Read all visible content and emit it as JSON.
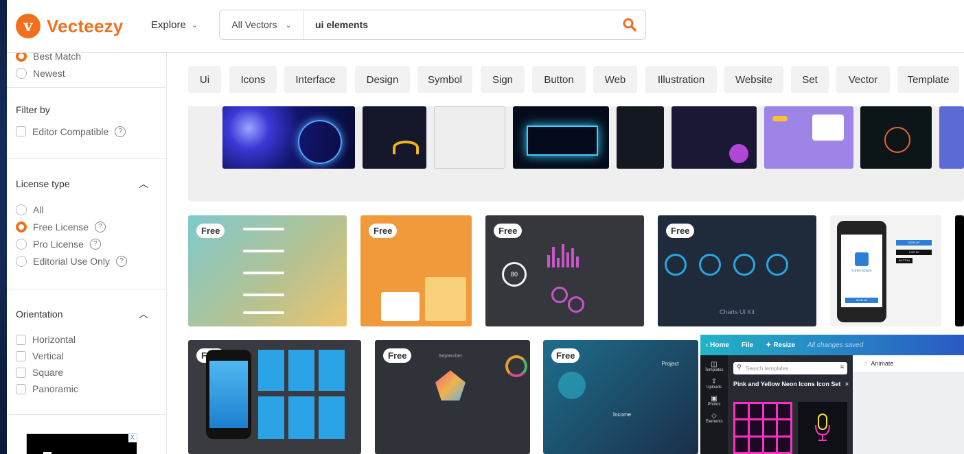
{
  "header": {
    "logo_text": "Vecteezy",
    "logo_mark": "v",
    "explore_label": "Explore",
    "search_type": "All Vectors",
    "search_value": "ui elements",
    "brand_color": "#f0701e"
  },
  "sidebar": {
    "sort_options": [
      {
        "label": "Best Match",
        "selected": true
      },
      {
        "label": "Newest",
        "selected": false
      }
    ],
    "filter_by": {
      "title": "Filter by",
      "options": [
        {
          "label": "Editor Compatible",
          "help": "?"
        }
      ]
    },
    "license": {
      "title": "License type",
      "options": [
        {
          "label": "All",
          "selected": false
        },
        {
          "label": "Free License",
          "selected": true,
          "help": "?"
        },
        {
          "label": "Pro License",
          "selected": false,
          "help": "?"
        },
        {
          "label": "Editorial Use Only",
          "selected": false,
          "help": "?"
        }
      ]
    },
    "orientation": {
      "title": "Orientation",
      "options": [
        "Horizontal",
        "Vertical",
        "Square",
        "Panoramic"
      ]
    },
    "ad_close": "X"
  },
  "chips": [
    "Ui",
    "Icons",
    "Interface",
    "Design",
    "Symbol",
    "Sign",
    "Button",
    "Web",
    "Illustration",
    "Website",
    "Set",
    "Vector",
    "Template"
  ],
  "results": {
    "badge": "Free",
    "card_texts": {
      "charts_title": "Charts UI Kit",
      "lorem": "Lorem Ipsum",
      "sign_up": "SIGN UP",
      "log_in": "LOG IN",
      "button": "BUTTON",
      "september": "September",
      "income": "Income",
      "project": "Project",
      "gauge": "80"
    }
  },
  "canva": {
    "home": "Home",
    "file": "File",
    "resize": "Resize",
    "saved": "All changes saved",
    "sidebar_items": [
      "Templates",
      "Uploads",
      "Photos",
      "Elements"
    ],
    "search_placeholder": "Search templates",
    "template_title": "Pink and Yellow Neon Icons Icon Set",
    "close": "×",
    "animate": "Animate"
  },
  "colors": {
    "accent": "#f0701e",
    "free_badge_bg": "#ffffff",
    "canva_gradient_start": "#21b4c7",
    "canva_gradient_end": "#2b59c3"
  }
}
